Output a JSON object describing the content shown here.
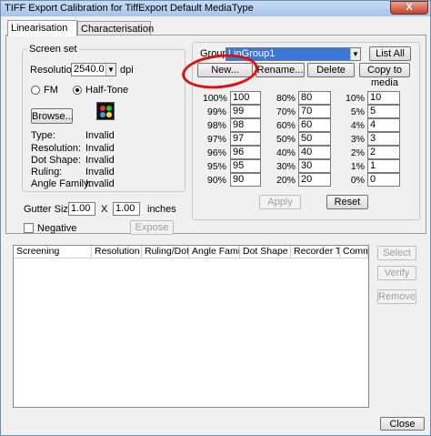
{
  "window": {
    "title": "TIFF Export Calibration for TiffExport Default MediaType",
    "close_glyph": "X"
  },
  "tabs": [
    "Linearisation",
    "Characterisation"
  ],
  "screen_set": {
    "legend": "Screen set",
    "resolution_label": "Resolution",
    "resolution_value": "2540.0",
    "resolution_unit": "dpi",
    "fm_label": "FM",
    "halftone_label": "Half-Tone",
    "selected_mode": "Half-Tone",
    "browse_label": "Browse...",
    "info": [
      {
        "label": "Type:",
        "value": "Invalid"
      },
      {
        "label": "Resolution:",
        "value": "Invalid"
      },
      {
        "label": "Dot Shape:",
        "value": "Invalid"
      },
      {
        "label": "Ruling:",
        "value": "Invalid"
      },
      {
        "label": "Angle Family:",
        "value": "Invalid"
      }
    ]
  },
  "gutter": {
    "label": "Gutter Size",
    "width": "1.00",
    "x": "X",
    "height": "1.00",
    "unit": "inches"
  },
  "negative_label": "Negative",
  "expose_label": "Expose",
  "group": {
    "legend": "Group",
    "selected": "LinGroup1",
    "list_all": "List All",
    "new": "New...",
    "rename": "Rename...",
    "delete": "Delete",
    "copy_to_media": "Copy to media",
    "apply": "Apply",
    "reset": "Reset",
    "columns": [
      [
        {
          "pct": "100%",
          "val": "100"
        },
        {
          "pct": "99%",
          "val": "99"
        },
        {
          "pct": "98%",
          "val": "98"
        },
        {
          "pct": "97%",
          "val": "97"
        },
        {
          "pct": "96%",
          "val": "96"
        },
        {
          "pct": "95%",
          "val": "95"
        },
        {
          "pct": "90%",
          "val": "90"
        }
      ],
      [
        {
          "pct": "80%",
          "val": "80"
        },
        {
          "pct": "70%",
          "val": "70"
        },
        {
          "pct": "60%",
          "val": "60"
        },
        {
          "pct": "50%",
          "val": "50"
        },
        {
          "pct": "40%",
          "val": "40"
        },
        {
          "pct": "30%",
          "val": "30"
        },
        {
          "pct": "20%",
          "val": "20"
        }
      ],
      [
        {
          "pct": "10%",
          "val": "10"
        },
        {
          "pct": "5%",
          "val": "5"
        },
        {
          "pct": "4%",
          "val": "4"
        },
        {
          "pct": "3%",
          "val": "3"
        },
        {
          "pct": "2%",
          "val": "2"
        },
        {
          "pct": "1%",
          "val": "1"
        },
        {
          "pct": "0%",
          "val": "0"
        }
      ]
    ]
  },
  "table": {
    "headers": [
      "Screening",
      "Resolution",
      "Ruling/Dot ...",
      "Angle Family",
      "Dot Shape",
      "Recorder Ty...",
      "Comment"
    ]
  },
  "side_buttons": {
    "select": "Select",
    "verify": "Verify",
    "remove": "Remove"
  },
  "close_label": "Close",
  "colors": {
    "selection": "#3a77d8",
    "annotation": "#e01010"
  }
}
